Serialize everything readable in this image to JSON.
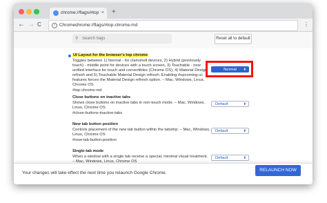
{
  "tab": {
    "title": "chrome://flags/#top-chro",
    "close": "×",
    "new_tab": "+"
  },
  "toolbar": {
    "back": "←",
    "forward": "→",
    "reload": "C",
    "chip": "Chrome",
    "separator": "|",
    "url": "chrome://flags/#top-chrome-md",
    "menu": "⋮"
  },
  "search": {
    "placeholder": "Search flags",
    "icon": "⚲"
  },
  "reset_button": "Reset all to default",
  "flags": [
    {
      "name": "UI Layout for the browser's top chrome",
      "description": "Toggles between 1) Normal - for clamshell devices, 2) Hybrid (previously touch) - middle point for devices with a touch screen, 3) Touchable - new unified interface for touch and convertibles (Chrome OS), 4) Material Design refresh and 5) Touchable Material Design refresh. Enabling #upcoming-ui-features forces the Material Design refresh option. – Mac, Windows, Linux, Chrome OS",
      "link": "#top-chrome-md",
      "value": "Normal"
    },
    {
      "name": "Close buttons on inactive tabs",
      "description": "Shows close buttons on inactive tabs in non-touch mode. – Mac, Windows, Linux, Chrome OS",
      "link": "#close-buttons-inactive-tabs",
      "value": "Default"
    },
    {
      "name": "New tab button position",
      "description": "Controls placement of the new tab button within the tabstrip. – Mac, Windows, Linux, Chrome OS",
      "link": "#new-tab-button-position",
      "value": "Default"
    },
    {
      "name": "Single-tab mode",
      "description": "When a window with a single tab receive a special, minimal visual treatment. – Mac, Windows, Linux, Chrome OS",
      "link": "",
      "value": "Default"
    }
  ],
  "select_arrow": "⬍",
  "footer": {
    "message": "Your changes will take effect the next time you relaunch Google Chrome.",
    "button": "RELAUNCH NOW"
  }
}
